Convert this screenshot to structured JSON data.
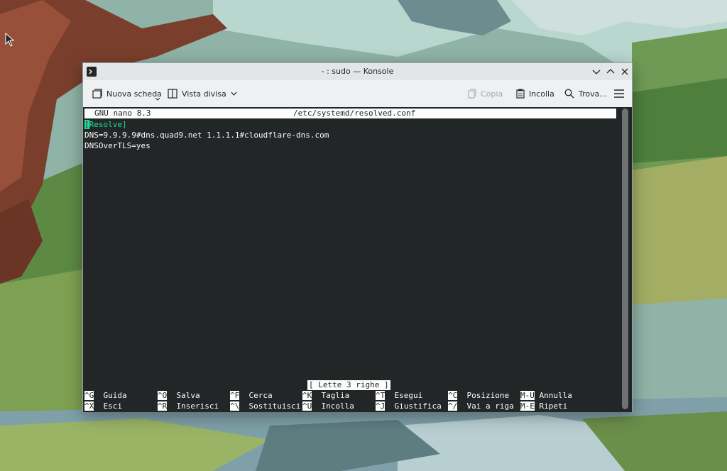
{
  "window": {
    "title": "- : sudo — Konsole"
  },
  "toolbar": {
    "new_tab": "Nuova scheda",
    "split_view": "Vista divisa",
    "copy": "Copia",
    "paste": "Incolla",
    "find": "Trova..."
  },
  "nano": {
    "version": "GNU nano 8.3",
    "filename": "/etc/systemd/resolved.conf",
    "lines": {
      "section": "[Resolve]",
      "dns": "DNS=9.9.9.9#dns.quad9.net 1.1.1.1#cloudflare-dns.com",
      "dot": "DNSOverTLS=yes"
    },
    "status": "[ Lette 3 righe ]",
    "shortcuts": [
      {
        "key": "^G",
        "label": "Guida"
      },
      {
        "key": "^X",
        "label": "Esci"
      },
      {
        "key": "^O",
        "label": "Salva"
      },
      {
        "key": "^R",
        "label": "Inserisci"
      },
      {
        "key": "^F",
        "label": "Cerca"
      },
      {
        "key": "^\\",
        "label": "Sostituisci"
      },
      {
        "key": "^K",
        "label": "Taglia"
      },
      {
        "key": "^U",
        "label": "Incolla"
      },
      {
        "key": "^T",
        "label": "Esegui"
      },
      {
        "key": "^J",
        "label": "Giustifica"
      },
      {
        "key": "^C",
        "label": "Posizione"
      },
      {
        "key": "^/",
        "label": "Vai a riga"
      },
      {
        "key": "M-U",
        "label": "Annulla"
      },
      {
        "key": "M-E",
        "label": "Ripeti"
      }
    ]
  },
  "colors": {
    "terminal_bg": "#232627",
    "terminal_fg": "#fcfcfc",
    "section_highlight": "#1cdc9a"
  }
}
